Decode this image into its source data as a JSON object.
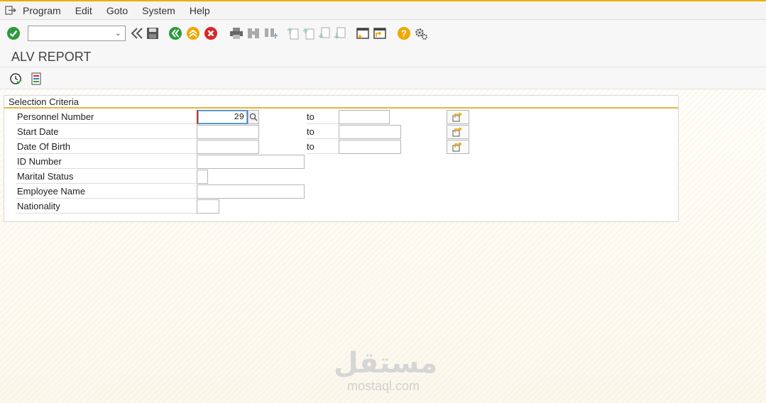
{
  "menu": {
    "items": [
      "Program",
      "Edit",
      "Goto",
      "System",
      "Help"
    ]
  },
  "toolbar": {
    "command_value": ""
  },
  "title": "ALV REPORT",
  "selection": {
    "title": "Selection Criteria",
    "to_label": "to",
    "rows": [
      {
        "label": "Personnel Number",
        "value": "29",
        "to_value": ""
      },
      {
        "label": "Start Date",
        "value": "",
        "to_value": ""
      },
      {
        "label": "Date Of Birth",
        "value": "",
        "to_value": ""
      },
      {
        "label": "ID Number",
        "value": ""
      },
      {
        "label": "Marital Status",
        "value": ""
      },
      {
        "label": "Employee Name",
        "value": ""
      },
      {
        "label": "Nationality",
        "value": ""
      }
    ]
  },
  "watermark": {
    "arabic": "مستقل",
    "latin": "mostaql.com"
  },
  "colors": {
    "accent": "#f0ab00",
    "green": "#2c9a3c",
    "yellow": "#f0a800",
    "red": "#d9262c",
    "focus": "#3a7fc8"
  }
}
